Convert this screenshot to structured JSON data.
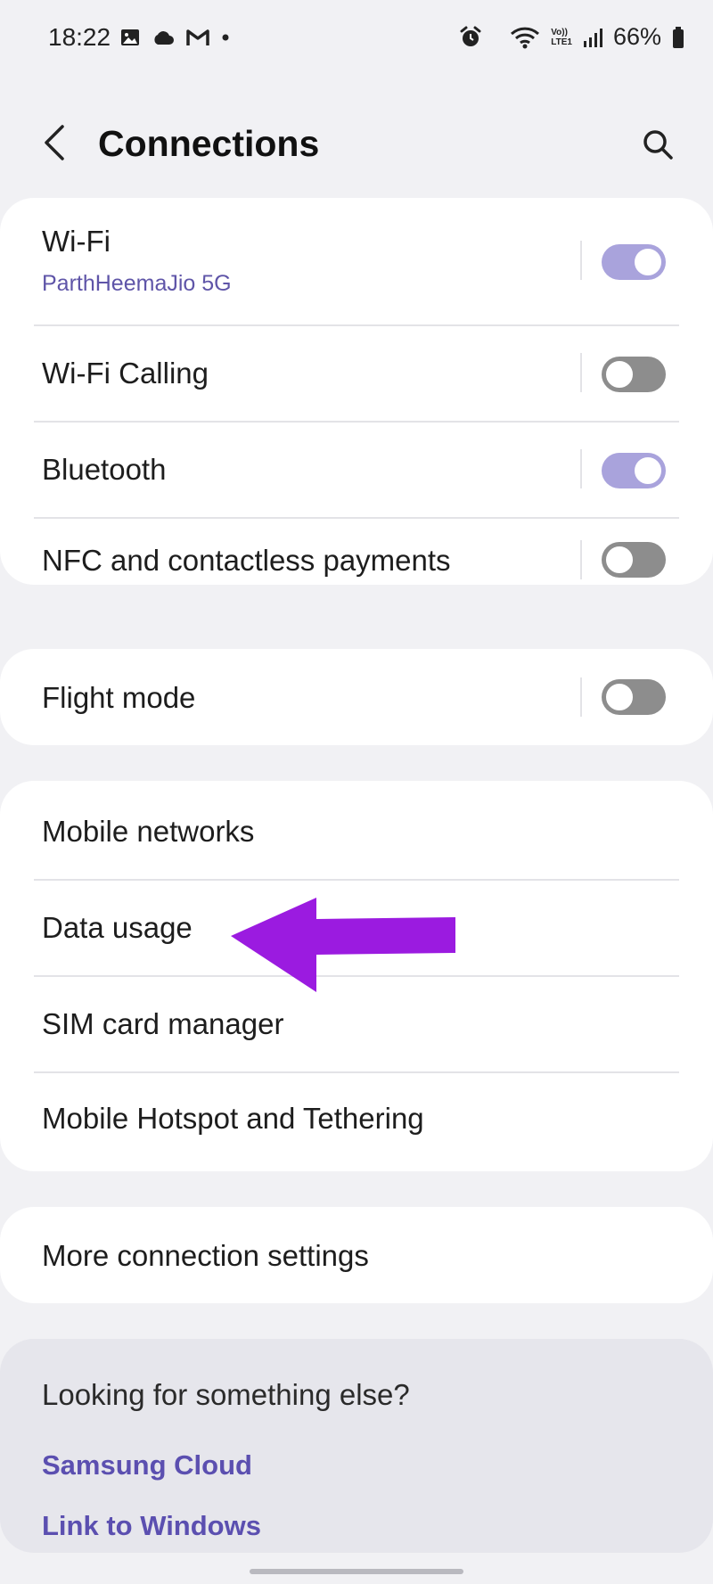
{
  "status_bar": {
    "time": "18:22",
    "volte_label": "Vo))\nLTE1",
    "battery": "66%"
  },
  "header": {
    "title": "Connections"
  },
  "group1": [
    {
      "label": "Wi-Fi",
      "subtitle": "ParthHeemaJio 5G",
      "toggle": "on"
    },
    {
      "label": "Wi-Fi Calling",
      "toggle": "off"
    },
    {
      "label": "Bluetooth",
      "toggle": "on"
    },
    {
      "label": "NFC and contactless payments",
      "toggle": "off"
    }
  ],
  "group2": [
    {
      "label": "Flight mode",
      "toggle": "off"
    }
  ],
  "group3": [
    {
      "label": "Mobile networks"
    },
    {
      "label": "Data usage"
    },
    {
      "label": "SIM card manager"
    },
    {
      "label": "Mobile Hotspot and Tethering"
    }
  ],
  "group4": [
    {
      "label": "More connection settings"
    }
  ],
  "suggestions": {
    "question": "Looking for something else?",
    "links": [
      "Samsung Cloud",
      "Link to Windows"
    ]
  },
  "colors": {
    "accent": "#5b4fb0",
    "toggle_on": "#a9a3dc",
    "toggle_off": "#8d8d8d",
    "annotation_arrow": "#9b1be0"
  }
}
